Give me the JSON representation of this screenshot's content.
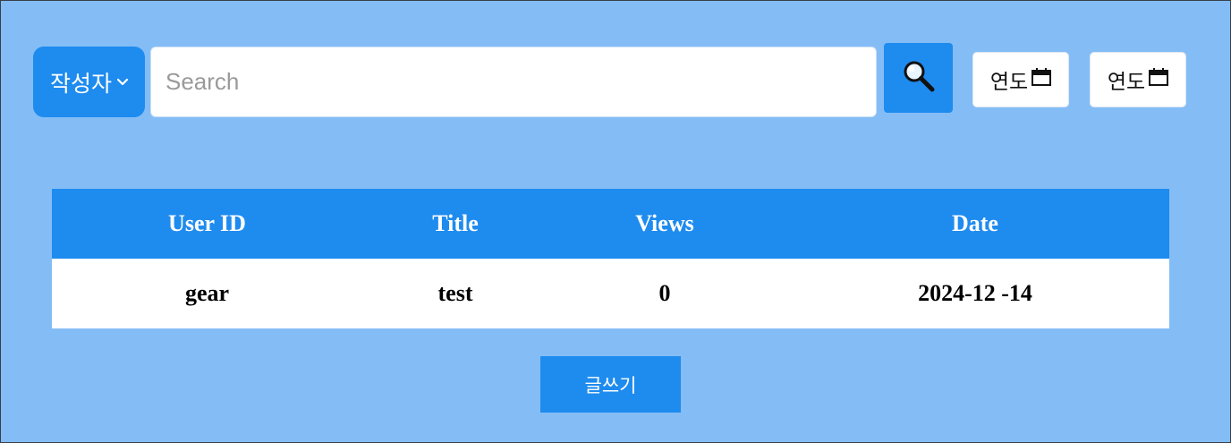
{
  "search": {
    "select_value": "작성자",
    "placeholder": "Search",
    "date_start_label": "연도",
    "date_end_label": "연도"
  },
  "table": {
    "headers": [
      "User ID",
      "Title",
      "Views",
      "Date"
    ],
    "rows": [
      {
        "user_id": "gear",
        "title": "test",
        "views": "0",
        "date": "2024-12 -14"
      }
    ]
  },
  "actions": {
    "write_label": "글쓰기"
  },
  "icons": {
    "select": "chevron-down-icon",
    "search": "magnifier-icon",
    "date": "calendar-icon"
  },
  "colors": {
    "background": "#84bdf6",
    "accent": "#1e8bef",
    "text_on_accent": "#ffffff"
  }
}
